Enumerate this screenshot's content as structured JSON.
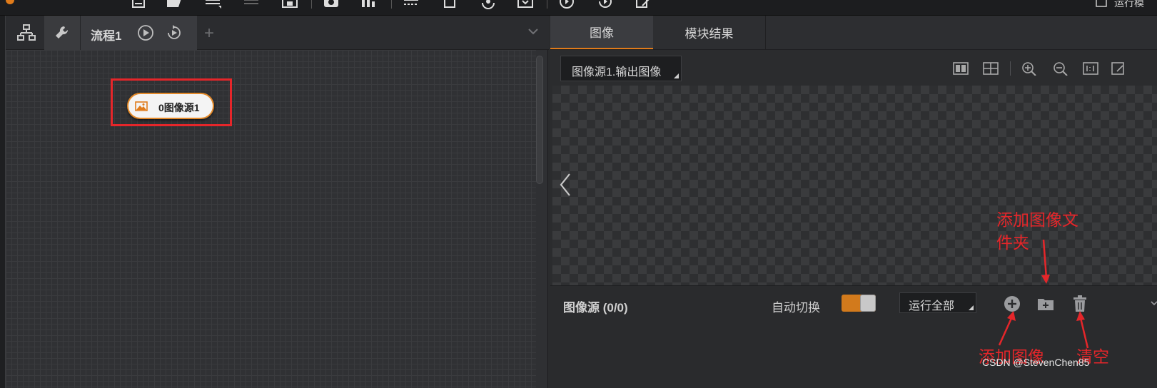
{
  "toolbar": {
    "run_label": "运行模"
  },
  "left_panel": {
    "flow_tab_label": "流程1",
    "plus_label": "+",
    "node_label": "0图像源1"
  },
  "right_panel": {
    "tabs": [
      "图像",
      "模块结果"
    ],
    "source_select": "图像源1.输出图像",
    "bottom": {
      "source_label": "图像源 (0/0)",
      "auto_switch_label": "自动切换",
      "auto_switch_on": true,
      "run_select": "运行全部"
    }
  },
  "annotations": {
    "add_folder": [
      "添加图像文",
      "件夹"
    ],
    "add_image": "添加图像",
    "clear": "清空"
  },
  "watermark": "CSDN @StevenChen85",
  "colors": {
    "accent": "#e07b1a",
    "annotation": "#e5262a"
  }
}
